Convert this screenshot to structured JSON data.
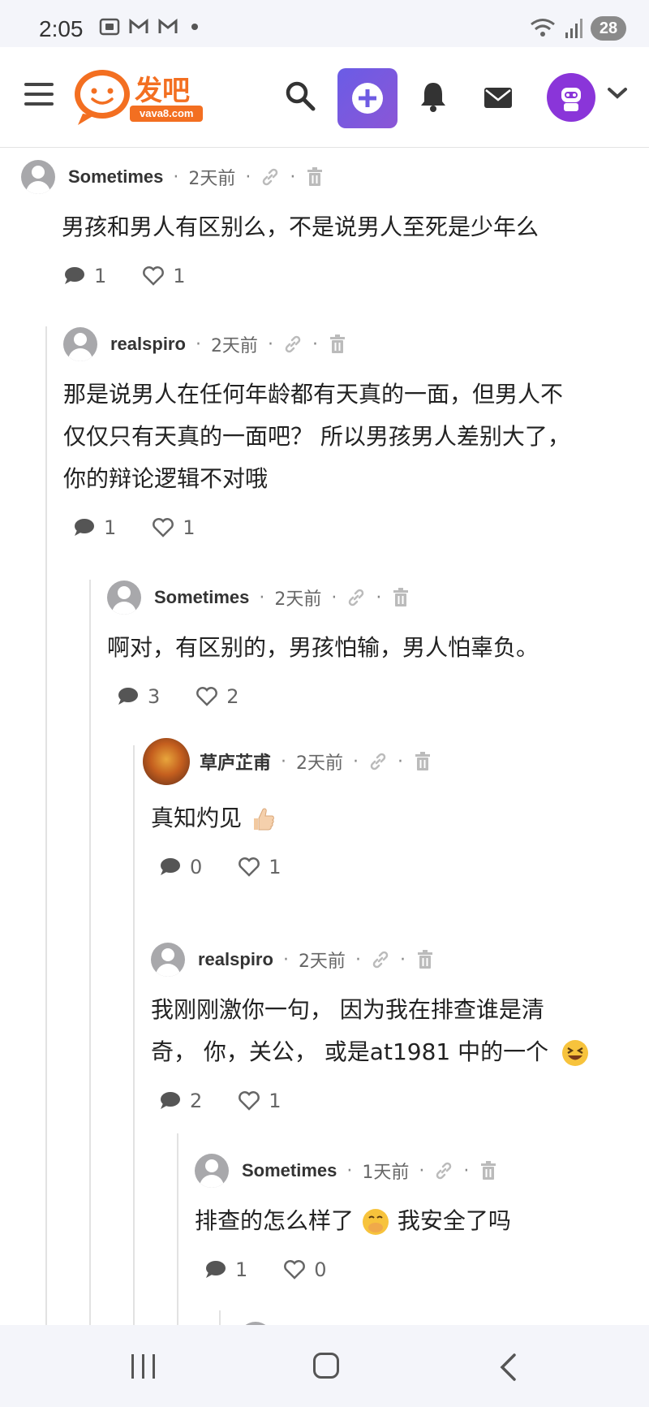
{
  "status_bar": {
    "time": "2:05",
    "battery": "28"
  },
  "header": {
    "logo_text": "发吧",
    "logo_sub": "vava8.com"
  },
  "comments": [
    {
      "author": "Sometimes",
      "time": "2天前",
      "lines": [
        "男孩和男人有区别么，不是说男人至死是少年么"
      ],
      "replies": "1",
      "likes": "1"
    },
    {
      "author": "realspiro",
      "time": "2天前",
      "lines": [
        "那是说男人在任何年龄都有天真的一面，但男人不",
        "仅仅只有天真的一面吧？ 所以男孩男人差别大了，",
        "你的辩论逻辑不对哦"
      ],
      "replies": "1",
      "likes": "1"
    },
    {
      "author": "Sometimes",
      "time": "2天前",
      "lines": [
        "啊对，有区别的，男孩怕输，男人怕辜负。"
      ],
      "replies": "3",
      "likes": "2"
    },
    {
      "author": "草庐芷甫",
      "time": "2天前",
      "lines": [
        "真知灼见"
      ],
      "replies": "0",
      "likes": "1"
    },
    {
      "author": "realspiro",
      "time": "2天前",
      "lines": [
        "我刚刚激你一句， 因为我在排查谁是清",
        "奇， 你，关公， 或是at1981 中的一个"
      ],
      "replies": "2",
      "likes": "1"
    },
    {
      "author": "Sometimes",
      "time": "1天前",
      "lines": [
        "排查的怎么样了",
        "我安全了吗"
      ],
      "replies": "1",
      "likes": "0"
    }
  ],
  "colors": {
    "accent": "#6e5be3",
    "avatar_purple": "#8a35d9",
    "logo_orange": "#f36f21"
  }
}
